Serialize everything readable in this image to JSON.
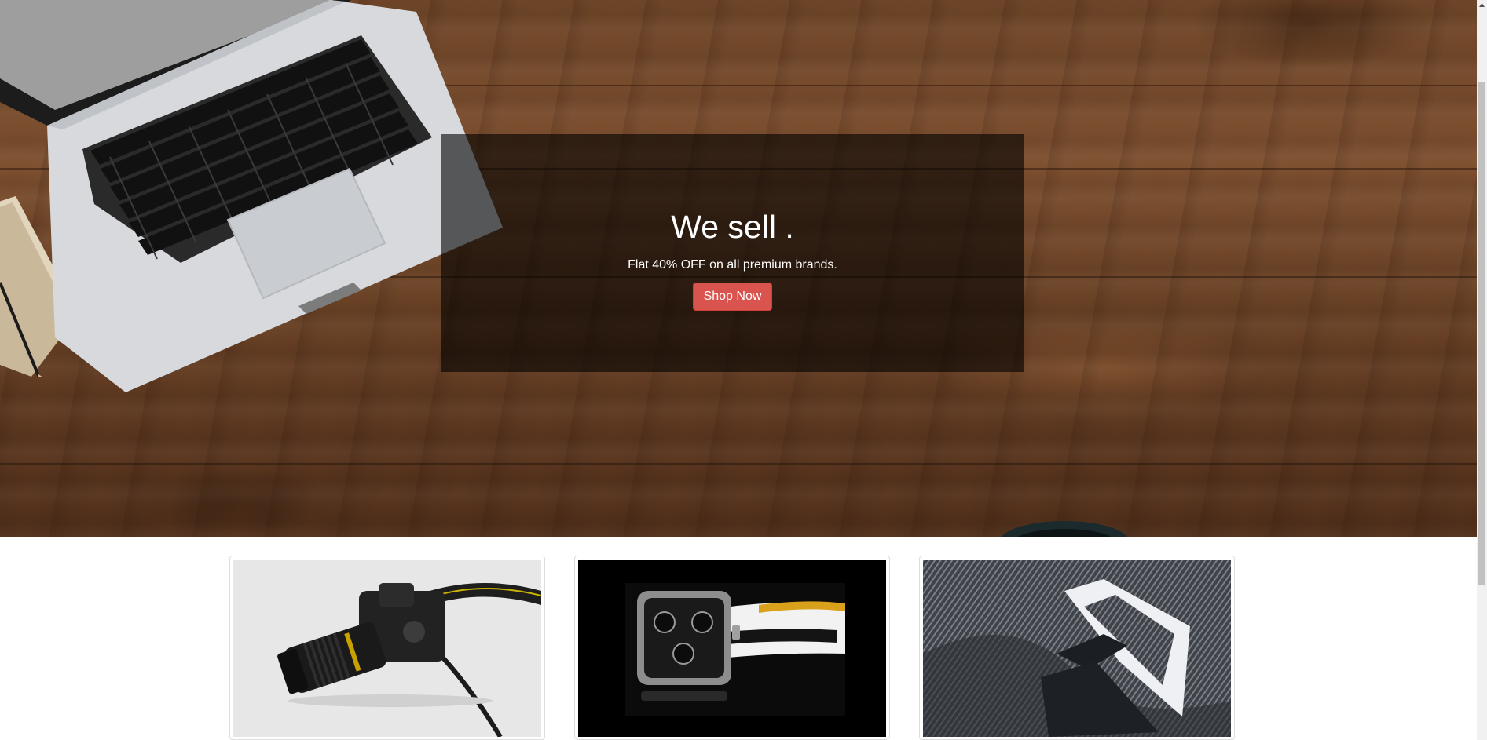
{
  "hero": {
    "title": "We sell .",
    "subtitle": "Flat 40% OFF on all premium brands.",
    "button_label": "Shop Now"
  },
  "products": [
    {
      "image_name": "camera-image"
    },
    {
      "image_name": "watch-image"
    },
    {
      "image_name": "shirt-image"
    }
  ],
  "colors": {
    "button": "#d9534f",
    "overlay": "rgba(0,0,0,0.6)"
  }
}
